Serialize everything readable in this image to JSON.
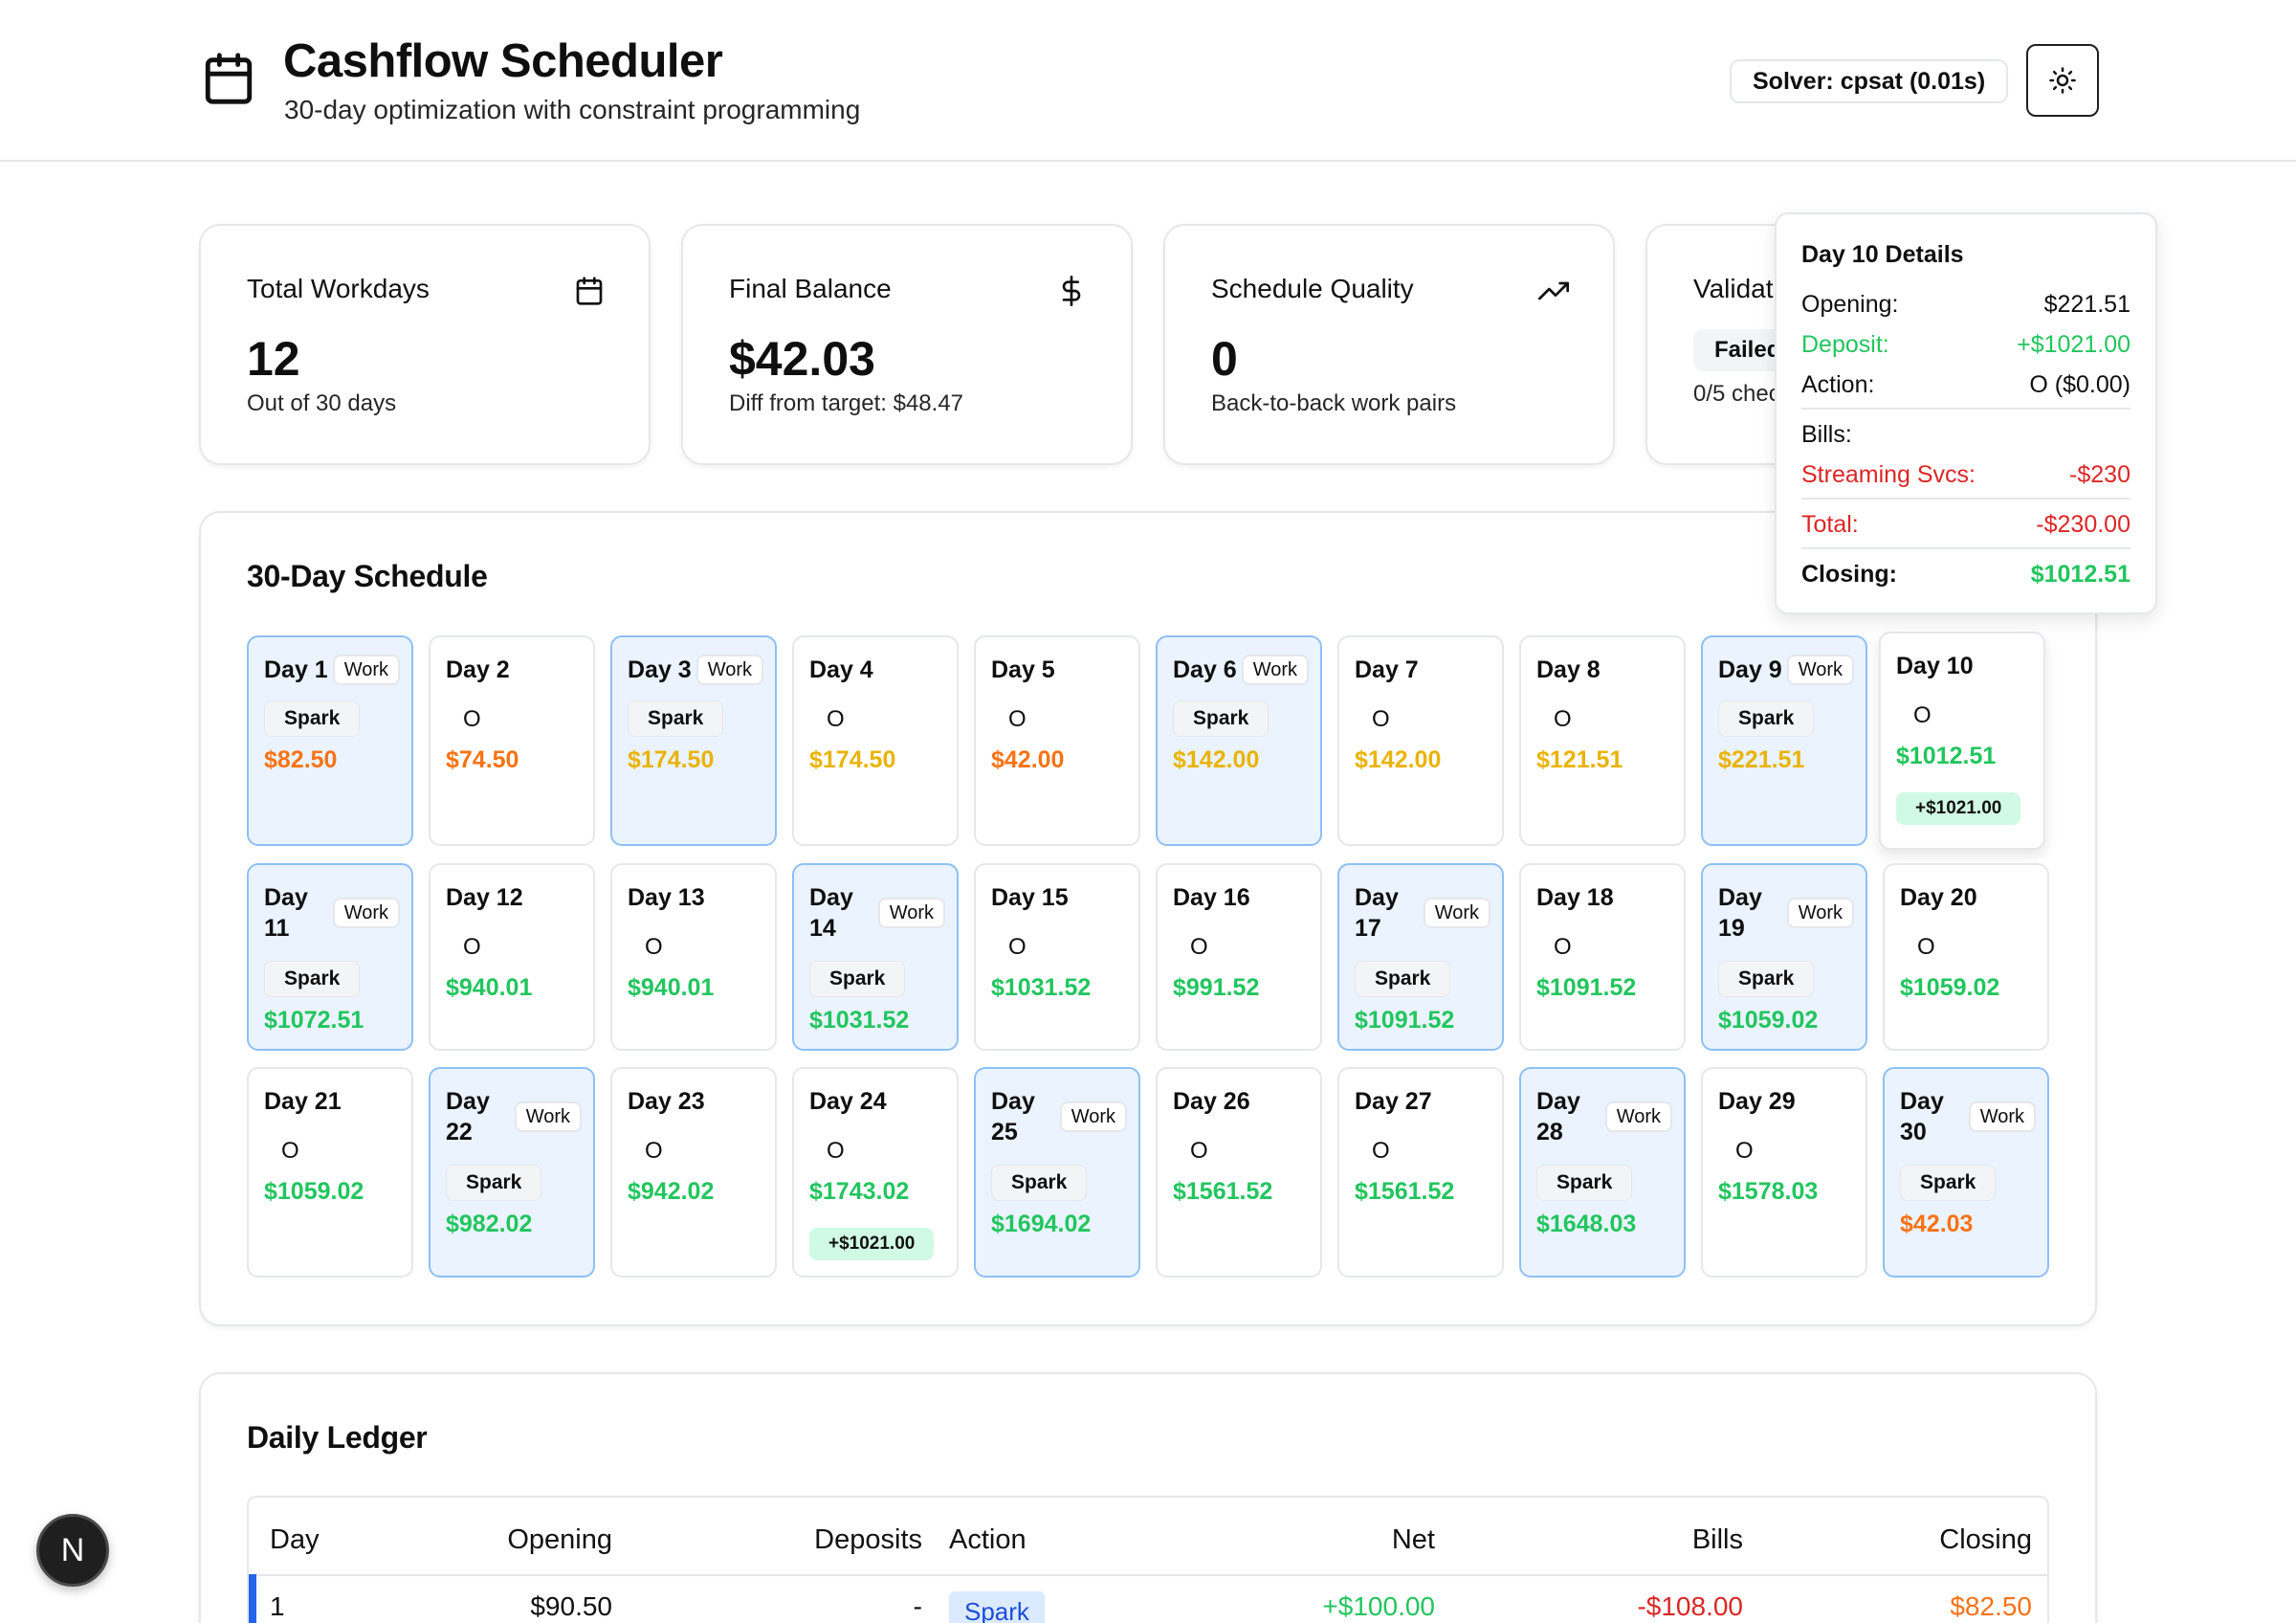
{
  "header": {
    "title": "Cashflow Scheduler",
    "subtitle": "30-day optimization with constraint programming",
    "solver_badge": "Solver: cpsat (0.01s)",
    "theme_icon": "sun-icon",
    "app_icon": "calendar-icon"
  },
  "stats": {
    "workdays": {
      "title": "Total Workdays",
      "value": "12",
      "sub": "Out of 30 days",
      "icon": "calendar-icon"
    },
    "balance": {
      "title": "Final Balance",
      "value": "$42.03",
      "sub": "Diff from target: $48.47",
      "icon": "dollar-icon"
    },
    "quality": {
      "title": "Schedule Quality",
      "value": "0",
      "sub": "Back-to-back work pairs",
      "icon": "trending-up-icon"
    },
    "validation": {
      "title": "Validation",
      "badge": "Failed",
      "sub": "0/5 checks",
      "icon": "x-circle-icon"
    }
  },
  "schedule": {
    "title": "30-Day Schedule",
    "work_label": "Work",
    "days": [
      {
        "label": "Day 1",
        "work": true,
        "action": "Spark",
        "balance": "$82.50",
        "color": "orange"
      },
      {
        "label": "Day 2",
        "work": false,
        "action": "O",
        "balance": "$74.50",
        "color": "orange"
      },
      {
        "label": "Day 3",
        "work": true,
        "action": "Spark",
        "balance": "$174.50",
        "color": "amber"
      },
      {
        "label": "Day 4",
        "work": false,
        "action": "O",
        "balance": "$174.50",
        "color": "amber"
      },
      {
        "label": "Day 5",
        "work": false,
        "action": "O",
        "balance": "$42.00",
        "color": "orange"
      },
      {
        "label": "Day 6",
        "work": true,
        "action": "Spark",
        "balance": "$142.00",
        "color": "amber"
      },
      {
        "label": "Day 7",
        "work": false,
        "action": "O",
        "balance": "$142.00",
        "color": "amber"
      },
      {
        "label": "Day 8",
        "work": false,
        "action": "O",
        "balance": "$121.51",
        "color": "amber"
      },
      {
        "label": "Day 9",
        "work": true,
        "action": "Spark",
        "balance": "$221.51",
        "color": "amber"
      },
      {
        "label": "Day 10",
        "work": false,
        "action": "O",
        "balance": "$1012.51",
        "color": "green",
        "deposit": "+$1021.00"
      },
      {
        "label": "Day 11",
        "work": true,
        "action": "Spark",
        "balance": "$1072.51",
        "color": "green"
      },
      {
        "label": "Day 12",
        "work": false,
        "action": "O",
        "balance": "$940.01",
        "color": "green"
      },
      {
        "label": "Day 13",
        "work": false,
        "action": "O",
        "balance": "$940.01",
        "color": "green"
      },
      {
        "label": "Day 14",
        "work": true,
        "action": "Spark",
        "balance": "$1031.52",
        "color": "green"
      },
      {
        "label": "Day 15",
        "work": false,
        "action": "O",
        "balance": "$1031.52",
        "color": "green"
      },
      {
        "label": "Day 16",
        "work": false,
        "action": "O",
        "balance": "$991.52",
        "color": "green"
      },
      {
        "label": "Day 17",
        "work": true,
        "action": "Spark",
        "balance": "$1091.52",
        "color": "green"
      },
      {
        "label": "Day 18",
        "work": false,
        "action": "O",
        "balance": "$1091.52",
        "color": "green"
      },
      {
        "label": "Day 19",
        "work": true,
        "action": "Spark",
        "balance": "$1059.02",
        "color": "green"
      },
      {
        "label": "Day 20",
        "work": false,
        "action": "O",
        "balance": "$1059.02",
        "color": "green"
      },
      {
        "label": "Day 21",
        "work": false,
        "action": "O",
        "balance": "$1059.02",
        "color": "green"
      },
      {
        "label": "Day 22",
        "work": true,
        "action": "Spark",
        "balance": "$982.02",
        "color": "green"
      },
      {
        "label": "Day 23",
        "work": false,
        "action": "O",
        "balance": "$942.02",
        "color": "green"
      },
      {
        "label": "Day 24",
        "work": false,
        "action": "O",
        "balance": "$1743.02",
        "color": "green",
        "deposit": "+$1021.00"
      },
      {
        "label": "Day 25",
        "work": true,
        "action": "Spark",
        "balance": "$1694.02",
        "color": "green"
      },
      {
        "label": "Day 26",
        "work": false,
        "action": "O",
        "balance": "$1561.52",
        "color": "green"
      },
      {
        "label": "Day 27",
        "work": false,
        "action": "O",
        "balance": "$1561.52",
        "color": "green"
      },
      {
        "label": "Day 28",
        "work": true,
        "action": "Spark",
        "balance": "$1648.03",
        "color": "green"
      },
      {
        "label": "Day 29",
        "work": false,
        "action": "O",
        "balance": "$1578.03",
        "color": "green"
      },
      {
        "label": "Day 30",
        "work": true,
        "action": "Spark",
        "balance": "$42.03",
        "color": "orange"
      }
    ]
  },
  "popover": {
    "title": "Day 10 Details",
    "opening_label": "Opening:",
    "opening_value": "$221.51",
    "deposit_label": "Deposit:",
    "deposit_value": "+$1021.00",
    "action_label": "Action:",
    "action_value": "O ($0.00)",
    "bills_label": "Bills:",
    "bill_name": "Streaming Svcs:",
    "bill_value": "-$230",
    "total_label": "Total:",
    "total_value": "-$230.00",
    "closing_label": "Closing:",
    "closing_value": "$1012.51"
  },
  "ledger": {
    "title": "Daily Ledger",
    "columns": [
      "Day",
      "Opening",
      "Deposits",
      "Action",
      "Net",
      "Bills",
      "Closing"
    ],
    "rows": [
      {
        "day": "1",
        "opening": "$90.50",
        "deposits": "-",
        "action": "Spark",
        "net": "+$100.00",
        "bills": "-$108.00",
        "closing": "$82.50"
      }
    ]
  },
  "floating_button": {
    "label": "N"
  },
  "colors": {
    "green": "#22c55e",
    "orange": "#f97316",
    "amber": "#eab308",
    "red": "#dc2626",
    "work_bg": "#eaf3ff",
    "work_border": "#8ec0f5"
  }
}
